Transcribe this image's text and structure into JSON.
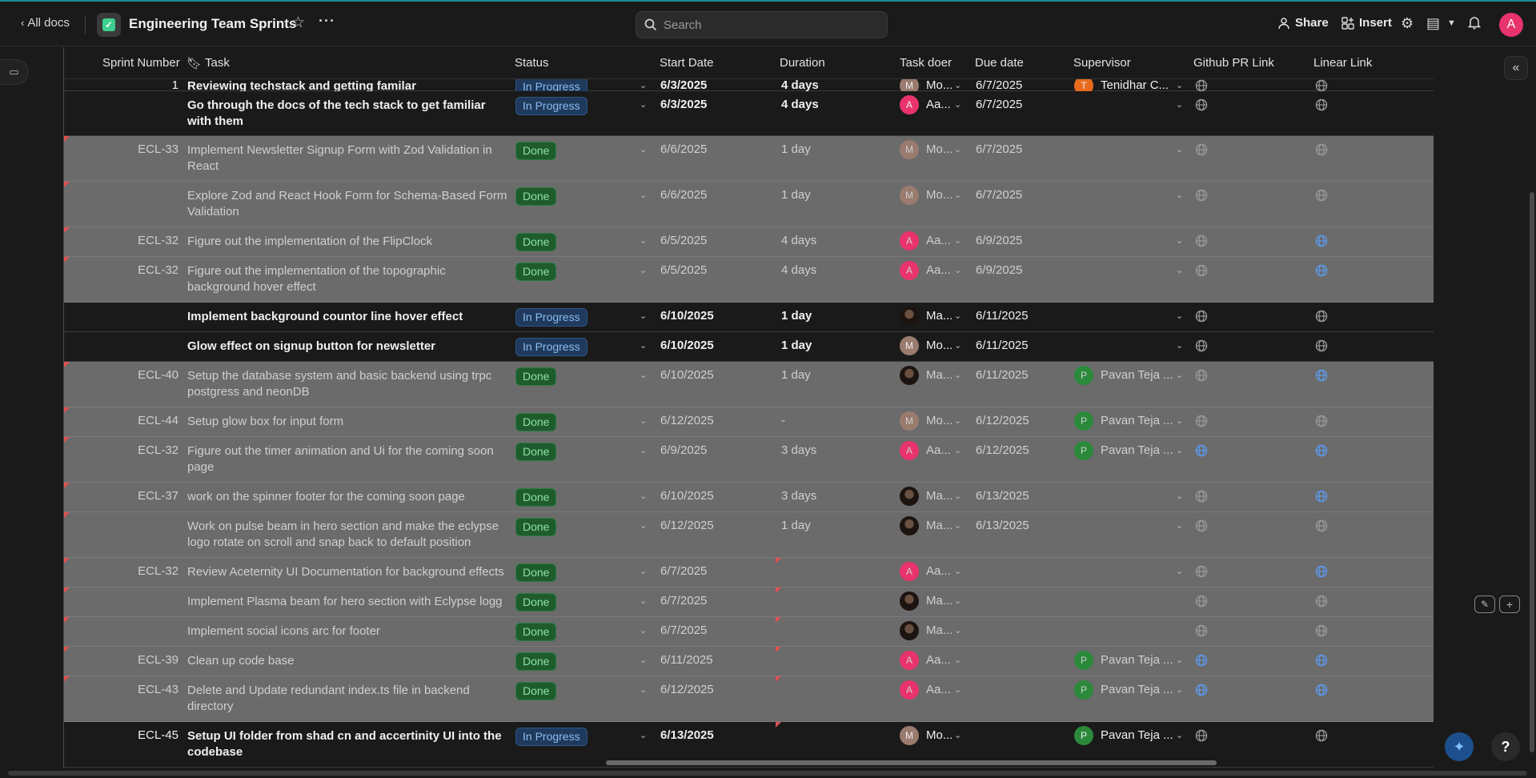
{
  "header": {
    "back_label": "All docs",
    "doc_title": "Engineering Team Sprints",
    "search_placeholder": "Search",
    "share_label": "Share",
    "insert_label": "Insert",
    "user_initial": "A"
  },
  "columns": [
    "Sprint Number",
    "Task",
    "Status",
    "Start Date",
    "Duration",
    "Task doer",
    "Due date",
    "Supervisor",
    "Github PR Link",
    "Linear Link"
  ],
  "rows": [
    {
      "sprint": "1",
      "task": "Reviewing techstack and getting familar",
      "status": "In Progress",
      "start": "6/3/2025",
      "duration": "4 days",
      "doer_initial": "M",
      "doer": "Mo...",
      "due": "6/7/2025",
      "sup_initial": "T",
      "supervisor": "Tenidhar C...",
      "gh": false,
      "ln": false
    },
    {
      "sprint": "",
      "task": "Go through the docs of the tech stack to get familiar with them",
      "status": "In Progress",
      "start": "6/3/2025",
      "duration": "4 days",
      "doer_initial": "A",
      "doer": "Aa...",
      "due": "6/7/2025",
      "sup_initial": "",
      "supervisor": "",
      "gh": false,
      "ln": false
    },
    {
      "sprint": "ECL-33",
      "task": "Implement Newsletter Signup Form with Zod Validation in React",
      "status": "Done",
      "start": "6/6/2025",
      "duration": "1 day",
      "doer_initial": "M",
      "doer": "Mo...",
      "due": "6/7/2025",
      "sup_initial": "",
      "supervisor": "",
      "gh": false,
      "ln": false
    },
    {
      "sprint": "",
      "task": "Explore Zod and React Hook Form for Schema-Based Form Validation",
      "status": "Done",
      "start": "6/6/2025",
      "duration": "1 day",
      "doer_initial": "M",
      "doer": "Mo...",
      "due": "6/7/2025",
      "sup_initial": "",
      "supervisor": "",
      "gh": false,
      "ln": false
    },
    {
      "sprint": "ECL-32",
      "task": "Figure out the implementation of the FlipClock",
      "status": "Done",
      "start": "6/5/2025",
      "duration": "4 days",
      "doer_initial": "A",
      "doer": "Aa...",
      "due": "6/9/2025",
      "sup_initial": "",
      "supervisor": "",
      "gh": false,
      "ln": true
    },
    {
      "sprint": "ECL-32",
      "task": "Figure out the implementation of the topographic background hover effect",
      "status": "Done",
      "start": "6/5/2025",
      "duration": "4 days",
      "doer_initial": "A",
      "doer": "Aa...",
      "due": "6/9/2025",
      "sup_initial": "",
      "supervisor": "",
      "gh": false,
      "ln": true
    },
    {
      "sprint": "",
      "task": "Implement background countor line hover effect",
      "status": "In Progress",
      "start": "6/10/2025",
      "duration": "1 day",
      "doer_initial": "",
      "doer": "Ma...",
      "due": "6/11/2025",
      "sup_initial": "",
      "supervisor": "",
      "gh": false,
      "ln": false
    },
    {
      "sprint": "",
      "task": "Glow effect on signup button for newsletter",
      "status": "In Progress",
      "start": "6/10/2025",
      "duration": "1 day",
      "doer_initial": "M",
      "doer": "Mo...",
      "due": "6/11/2025",
      "sup_initial": "",
      "supervisor": "",
      "gh": false,
      "ln": false
    },
    {
      "sprint": "ECL-40",
      "task": "Setup the database system and basic backend using trpc postgress and neonDB",
      "status": "Done",
      "start": "6/10/2025",
      "duration": "1 day",
      "doer_initial": "",
      "doer": "Ma...",
      "due": "6/11/2025",
      "sup_initial": "P",
      "supervisor": "Pavan Teja ...",
      "gh": false,
      "ln": true
    },
    {
      "sprint": "ECL-44",
      "task": "Setup glow box for input form",
      "status": "Done",
      "start": "6/12/2025",
      "duration": "-",
      "doer_initial": "M",
      "doer": "Mo...",
      "due": "6/12/2025",
      "sup_initial": "P",
      "supervisor": "Pavan Teja ...",
      "gh": false,
      "ln": false
    },
    {
      "sprint": "ECL-32",
      "task": "Figure out the timer animation and Ui for the coming soon page",
      "status": "Done",
      "start": "6/9/2025",
      "duration": "3 days",
      "doer_initial": "A",
      "doer": "Aa...",
      "due": "6/12/2025",
      "sup_initial": "P",
      "supervisor": "Pavan Teja ...",
      "gh": true,
      "ln": true
    },
    {
      "sprint": "ECL-37",
      "task": "work on the spinner footer for the coming soon page",
      "status": "Done",
      "start": "6/10/2025",
      "duration": "3 days",
      "doer_initial": "",
      "doer": "Ma...",
      "due": "6/13/2025",
      "sup_initial": "",
      "supervisor": "",
      "gh": false,
      "ln": true
    },
    {
      "sprint": "",
      "task": "Work on pulse beam in hero section and make the eclypse logo rotate on scroll and snap back to default position",
      "status": "Done",
      "start": "6/12/2025",
      "duration": "1 day",
      "doer_initial": "",
      "doer": "Ma...",
      "due": "6/13/2025",
      "sup_initial": "",
      "supervisor": "",
      "gh": false,
      "ln": false
    },
    {
      "sprint": "ECL-32",
      "task": "Review Aceternity UI Documentation for background effects",
      "status": "Done",
      "start": "6/7/2025",
      "duration": "",
      "doer_initial": "A",
      "doer": "Aa...",
      "due": "",
      "sup_initial": "",
      "supervisor": "",
      "gh": false,
      "ln": true
    },
    {
      "sprint": "",
      "task": "Implement Plasma beam for hero section with Eclypse logg",
      "status": "Done",
      "start": "6/7/2025",
      "duration": "",
      "doer_initial": "",
      "doer": "Ma...",
      "due": "",
      "sup_initial": "",
      "supervisor": "",
      "gh": false,
      "ln": false
    },
    {
      "sprint": "",
      "task": "Implement social icons arc for footer",
      "status": "Done",
      "start": "6/7/2025",
      "duration": "",
      "doer_initial": "",
      "doer": "Ma...",
      "due": "",
      "sup_initial": "",
      "supervisor": "",
      "gh": false,
      "ln": false
    },
    {
      "sprint": "ECL-39",
      "task": "Clean up code base",
      "status": "Done",
      "start": "6/11/2025",
      "duration": "",
      "doer_initial": "A",
      "doer": "Aa...",
      "due": "",
      "sup_initial": "P",
      "supervisor": "Pavan Teja ...",
      "gh": true,
      "ln": true
    },
    {
      "sprint": "ECL-43",
      "task": "Delete and Update redundant index.ts file in backend directory",
      "status": "Done",
      "start": "6/12/2025",
      "duration": "",
      "doer_initial": "A",
      "doer": "Aa...",
      "due": "",
      "sup_initial": "P",
      "supervisor": "Pavan Teja ...",
      "gh": true,
      "ln": true
    },
    {
      "sprint": "ECL-45",
      "task": "Setup UI folder from shad cn and accertinity UI into the codebase",
      "status": "In Progress",
      "start": "6/13/2025",
      "duration": "",
      "doer_initial": "M",
      "doer": "Mo...",
      "due": "",
      "sup_initial": "P",
      "supervisor": "Pavan Teja ...",
      "gh": false,
      "ln": false
    }
  ],
  "colors": {
    "done_badge": "#1e5c2e",
    "progress_badge": "#1f3a5c",
    "link_blue": "#5b9bf0",
    "accent_pink": "#e8336d"
  }
}
